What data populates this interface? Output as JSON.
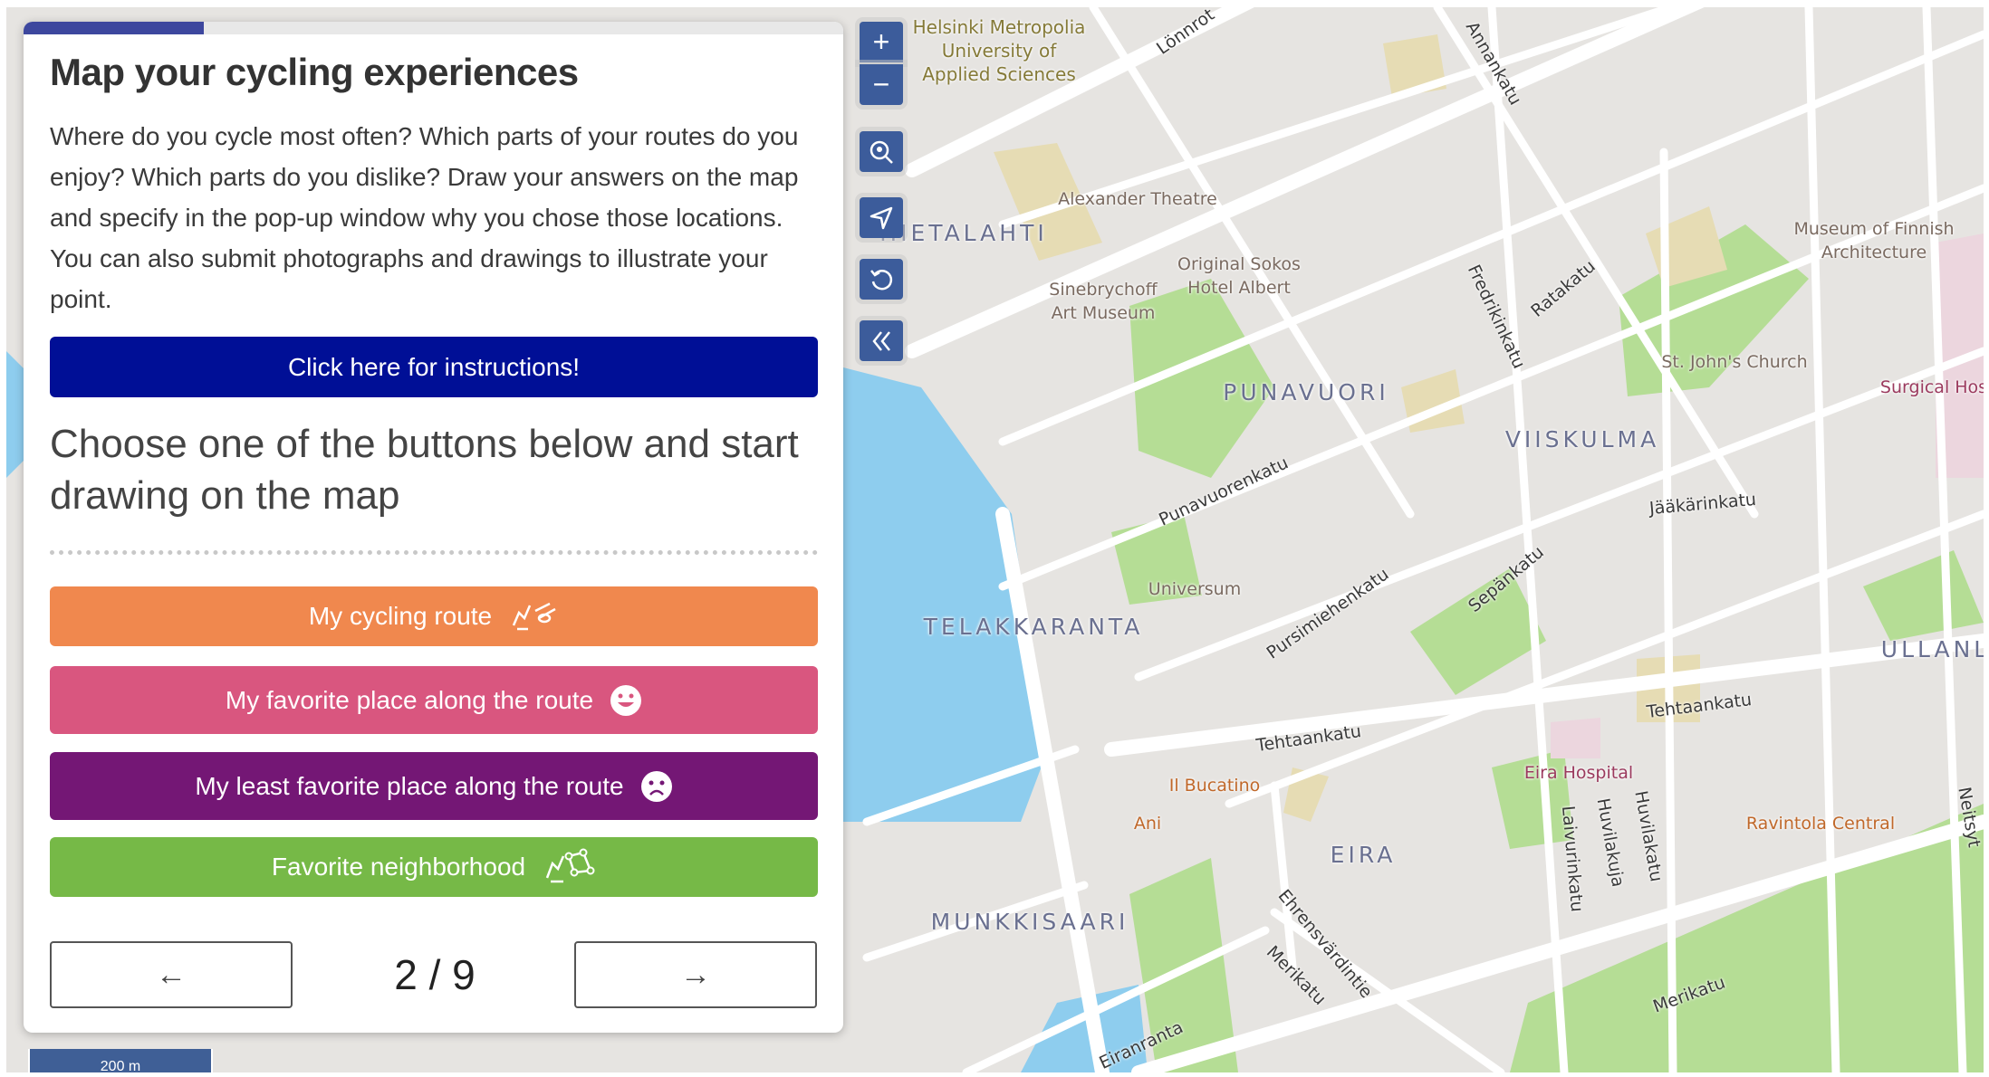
{
  "panel": {
    "progress_percent": 22,
    "title": "Map your cycling experiences",
    "intro": "Where do you cycle most often? Which parts of your routes do you enjoy? Which parts do you dislike? Draw your answers on the map and specify in the pop-up window why you chose those locations. You can also submit photographs and drawings to illustrate your point.",
    "instructions_button": "Click here for instructions!",
    "choose_heading": "Choose one of the buttons below and start drawing on the map",
    "draw_buttons": [
      {
        "label": "My cycling route",
        "icon": "draw-line-icon",
        "color": "#f0884e"
      },
      {
        "label": "My favorite place along the route",
        "icon": "smiley-happy-icon",
        "color": "#d9567f"
      },
      {
        "label": "My least favorite place along the route",
        "icon": "smiley-sad-icon",
        "color": "#741775"
      },
      {
        "label": "Favorite neighborhood",
        "icon": "draw-polygon-icon",
        "color": "#76b947"
      }
    ],
    "prev_icon": "←",
    "next_icon": "→",
    "page_indicator": "2 / 9"
  },
  "map_controls": {
    "zoom_in": "+",
    "zoom_out": "−",
    "icons": [
      "search-location-icon",
      "locate-arrow-icon",
      "reset-icon",
      "collapse-double-chevron-icon"
    ]
  },
  "map": {
    "scale_label": "200 m",
    "labels": {
      "metropolia": "Helsinki Metropolia University of Applied Sciences",
      "lonnrot": "Lönnrot",
      "annankatu": "Annankatu",
      "alexander": "Alexander Theatre",
      "hietalahti": "HIETALAHTI",
      "sokos": "Original Sokos Hotel Albert",
      "sinebrychoff": "Sinebrychoff Art Museum",
      "fredrikinkatu": "Fredrikinkatu",
      "ratakatu": "Ratakatu",
      "museum_arch": "Museum of Finnish Architecture",
      "st_john": "St. John's Church",
      "surgical": "Surgical Hos",
      "punavuori": "PUNAVUORI",
      "viiskulma": "VIISKULMA",
      "punavuorenkatu": "Punavuorenkatu",
      "jaakarinkatu": "Jääkärinkatu",
      "universum": "Universum",
      "telakkaranta": "TELAKKARANTA",
      "pursimiehenkatu": "Pursimiehenkatu",
      "sepankatu": "Sepänkatu",
      "ullanl": "ULLANL",
      "tehtaankatu": "Tehtaankatu",
      "eira_hospital": "Eira Hospital",
      "il_bucatino": "Il Bucatino",
      "ani": "Ani",
      "ravintola": "Ravintola Central",
      "laivurinkatu": "Laivurinkatu",
      "huvilakuja": "Huvilakuja",
      "huvilakatu": "Huvilakatu",
      "neitsyt": "Neitsyt",
      "eira": "EIRA",
      "munkkisaari": "MUNKKISAARI",
      "ehrensvardintie": "Ehrensvärdintie",
      "merikatu": "Merikatu",
      "eiranranta": "Eiranranta"
    }
  }
}
